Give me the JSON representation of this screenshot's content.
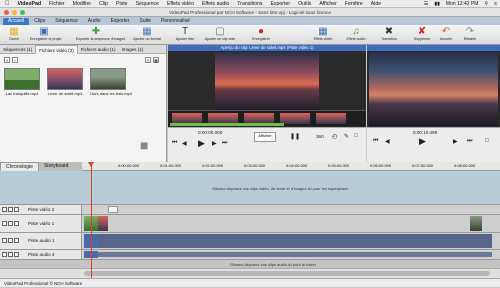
{
  "menubar": {
    "app": "VideoPad",
    "items": [
      "Fichier",
      "Modifier",
      "Clip",
      "Piste",
      "Séquence",
      "Effets vidéo",
      "Effets audio",
      "Transitions",
      "Exporter",
      "Outils",
      "Afficher",
      "Fenêtre",
      "Aide"
    ],
    "clock": "Mon 12:42 PM"
  },
  "window": {
    "title": "VideoPad Professional par NCH Software - Sans titre.vpj - Logiciel sous licence"
  },
  "ribbon_tabs": [
    "Accueil",
    "Clips",
    "Séquence",
    "Audio",
    "Exporter",
    "Suite",
    "Personnalisé"
  ],
  "toolbar": [
    {
      "label": "Ouvrir",
      "icon": "folder-icon",
      "color": "#e8b028"
    },
    {
      "label": "Enregistrer le projet",
      "icon": "save-icon",
      "color": "#3b6fb8"
    },
    {
      "label": "Exporter la séquence d'images",
      "icon": "export-icon",
      "color": "#4a9a40"
    },
    {
      "label": "Ajouter un format",
      "icon": "add-format-icon",
      "color": "#4a7ab8"
    },
    {
      "label": "Ajouter titre",
      "icon": "title-icon",
      "color": "#333333"
    },
    {
      "label": "Ajouter un clip vide",
      "icon": "blank-clip-icon",
      "color": "#6a6a6a"
    },
    {
      "label": "Enregistrer",
      "icon": "record-icon",
      "color": "#d32020"
    },
    {
      "label": "Effets vidéo",
      "icon": "video-effects-icon",
      "color": "#3b6fb8"
    },
    {
      "label": "Effets audio",
      "icon": "audio-effects-icon",
      "color": "#4a9a40"
    },
    {
      "label": "Transition",
      "icon": "transition-icon",
      "color": "#333333"
    },
    {
      "label": "Supprimer",
      "icon": "delete-icon",
      "color": "#d32020"
    },
    {
      "label": "Annuler",
      "icon": "undo-icon",
      "color": "#d36020"
    },
    {
      "label": "Rétablir",
      "icon": "redo-icon",
      "color": "#888888"
    }
  ],
  "bin": {
    "tabs": [
      "Séquences (1)",
      "Fichiers vidéo (3)",
      "Fichiers audio (1)",
      "Images (1)"
    ],
    "clips": [
      {
        "name": "Lac tranquille.mp4",
        "sky": "#7fae6c",
        "ground": "#3c6e2c"
      },
      {
        "name": "Lever de soleil.mp4",
        "sky": "#d9645a",
        "ground": "#3a3550"
      },
      {
        "name": "Ours dans les bois.mp4",
        "sky": "#8a9a88",
        "ground": "#384230"
      }
    ]
  },
  "preview_left": {
    "title": "Aperçu du clip: Lever de soleil.mp4 (Piste vidéo 1)",
    "time": "0:00:00.000",
    "afficher": "Afficher",
    "degree": "360"
  },
  "preview_right": {
    "time": "0:00:10.498"
  },
  "timeline": {
    "tabs": [
      "Chronologie",
      "Storyboard"
    ],
    "ticks": [
      "0:00:00.000",
      "0:01:00.000",
      "0:02:00.000",
      "0:03:00.000",
      "0:04:00.000",
      "0:05:00.000",
      "0:06:00.000",
      "0:07:00.000",
      "0:08:00.000",
      "0:09:00.000"
    ],
    "overlay_hint": "Glissez-déposez vos clips vidéo, de texte et d'images ici pour les superposer",
    "audio_hint": "Glissez-déposez vos clips audio ici pour le mixer",
    "tracks": [
      "Piste vidéo 2",
      "Piste vidéo 1",
      "Piste audio 1",
      "Piste audio 2"
    ]
  },
  "status": "VideoPad Professional © NCH Software"
}
